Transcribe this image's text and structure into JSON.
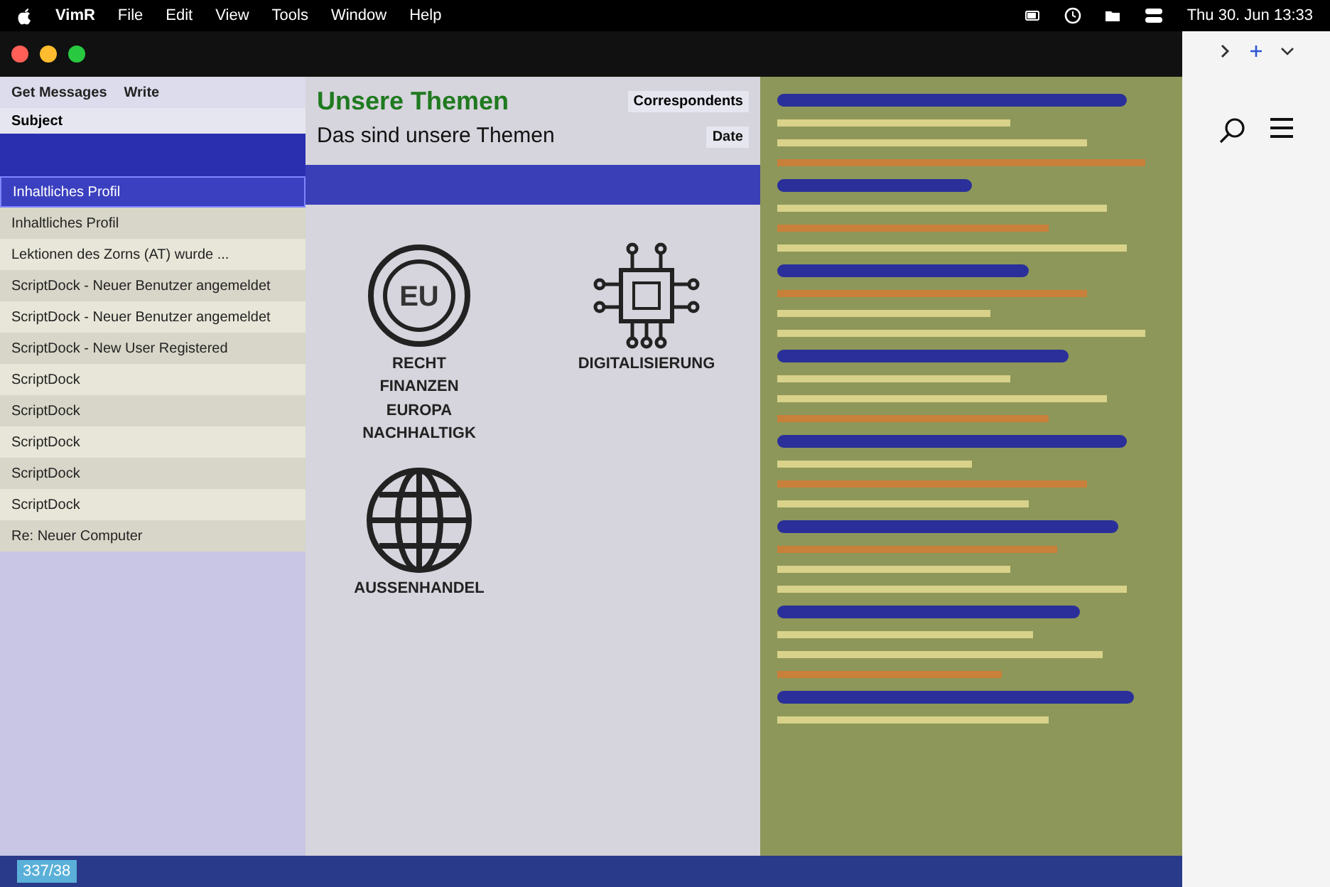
{
  "menu_bar": {
    "app": "VimR",
    "menus": [
      "File",
      "Edit",
      "View",
      "Tools",
      "Window",
      "Help"
    ],
    "clock": "Thu 30. Jun 13:33"
  },
  "mail": {
    "toolbar": [
      "Get Messages",
      "Write"
    ],
    "columns": [
      "Subject",
      "Correspondents",
      "Date"
    ],
    "rows": [
      {
        "subject": "Inhaltliches Profil",
        "selected": true
      },
      {
        "subject": "Inhaltliches Profil",
        "selected": false
      },
      {
        "subject": "Lektionen des Zorns (AT) wurde ...",
        "selected": false
      },
      {
        "subject": "ScriptDock - Neuer Benutzer angemeldet",
        "selected": false
      },
      {
        "subject": "ScriptDock - Neuer Benutzer angemeldet",
        "selected": false
      },
      {
        "subject": "ScriptDock - New User Registered",
        "selected": false
      },
      {
        "subject": "ScriptDock",
        "selected": false
      },
      {
        "subject": "ScriptDock",
        "selected": false
      },
      {
        "subject": "ScriptDock",
        "selected": false
      },
      {
        "subject": "ScriptDock",
        "selected": false
      },
      {
        "subject": "ScriptDock",
        "selected": false
      },
      {
        "subject": "Re: Neuer Computer",
        "selected": false
      }
    ]
  },
  "web": {
    "heading": "Unsere Themen",
    "subheading": "Das sind unsere Themen",
    "topics": [
      {
        "kind": "eu",
        "badge": "EU",
        "labels": [
          "RECHT",
          "FINANZEN",
          "EUROPA",
          "NACHHALTIGK"
        ]
      },
      {
        "kind": "chip",
        "labels": [
          "DIGITALISIERUNG"
        ]
      },
      {
        "kind": "globe",
        "labels": [
          "AUSSENHANDEL"
        ]
      }
    ]
  },
  "status": "337/38"
}
